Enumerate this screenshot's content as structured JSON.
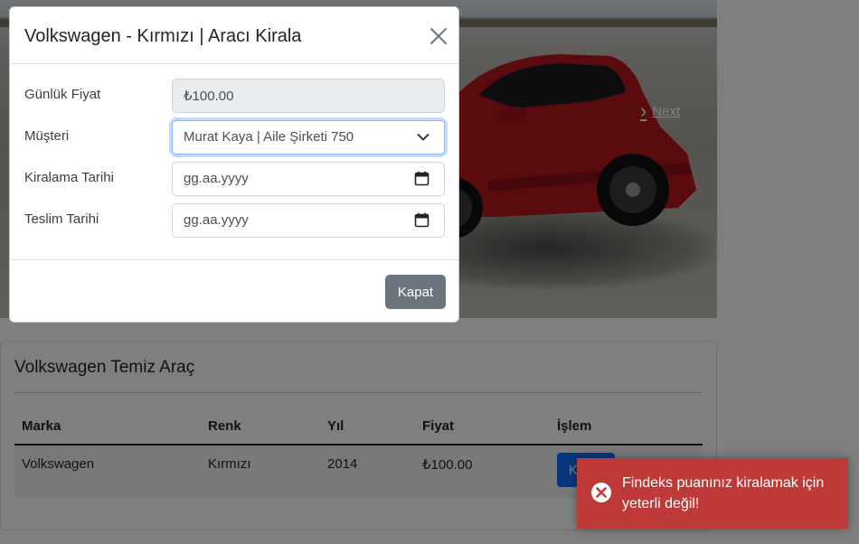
{
  "modal": {
    "title": "Volkswagen - Kırmızı | Aracı Kirala",
    "fields": [
      {
        "label": "Günlük Fiyat",
        "value": "₺100.00"
      },
      {
        "label": "Müşteri",
        "value": "Murat Kaya | Aile Şirketi 750"
      },
      {
        "label": "Kiralama Tarihi",
        "placeholder": "gg.aa.yyyy"
      },
      {
        "label": "Teslim Tarihi",
        "placeholder": "gg.aa.yyyy"
      }
    ],
    "close_label": "Kapat"
  },
  "carousel": {
    "next_label": "Next"
  },
  "card": {
    "title": "Volkswagen Temiz Araç",
    "columns": [
      "Marka",
      "Renk",
      "Yıl",
      "Fiyat",
      "İşlem"
    ],
    "rows": [
      {
        "marka": "Volkswagen",
        "renk": "Kırmızı",
        "yil": "2014",
        "fiyat": "₺100.00",
        "action": "Kirala"
      }
    ]
  },
  "toast": {
    "message": "Findeks puanınız kiralamak için yeterli değil!",
    "icon": "error-circle-icon",
    "color": "#bd3a38"
  },
  "colors": {
    "primary": "#0d6efd",
    "secondary": "#6c757d",
    "focus_border": "#86b7fe"
  }
}
